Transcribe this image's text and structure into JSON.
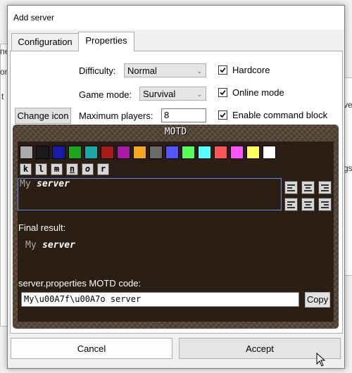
{
  "dialog": {
    "title": "Add server"
  },
  "tabs": [
    {
      "label": "Configuration"
    },
    {
      "label": "Properties"
    }
  ],
  "properties": {
    "difficulty_label": "Difficulty:",
    "difficulty_value": "Normal",
    "gamemode_label": "Game mode:",
    "gamemode_value": "Survival",
    "maxplayers_label": "Maximum players:",
    "maxplayers_value": "8",
    "change_icon_label": "Change icon",
    "hardcore_label": "Hardcore",
    "hardcore_checked": true,
    "online_mode_label": "Online mode",
    "online_mode_checked": true,
    "command_block_label": "Enable command block",
    "command_block_checked": true
  },
  "motd": {
    "title": "MOTD",
    "colors": [
      "#aaaaaa",
      "#1a1a1a",
      "#1a1aa8",
      "#1aa81a",
      "#1aa8a8",
      "#a81a1a",
      "#a81aa8",
      "#f7a81a",
      "#6a6a6a",
      "#5555ff",
      "#55ff55",
      "#55ffff",
      "#ff5555",
      "#ff55ff",
      "#ffff55",
      "#ffffff"
    ],
    "format_buttons": [
      "k",
      "l",
      "m",
      "n",
      "o",
      "r"
    ],
    "editor_text_plain": "My",
    "editor_text_styled": "server",
    "final_result_label": "Final result:",
    "preview_text_plain": "My",
    "preview_text_styled": "server",
    "code_label": "server.properties MOTD code:",
    "code_value": "My\\u00A7f\\u00A7o server",
    "copy_label": "Copy"
  },
  "buttons": {
    "cancel": "Cancel",
    "accept": "Accept"
  },
  "background": {
    "text_1": "ne",
    "text_2": "on",
    "text_3": "t",
    "text_4": "ve",
    "text_5": "gs"
  }
}
